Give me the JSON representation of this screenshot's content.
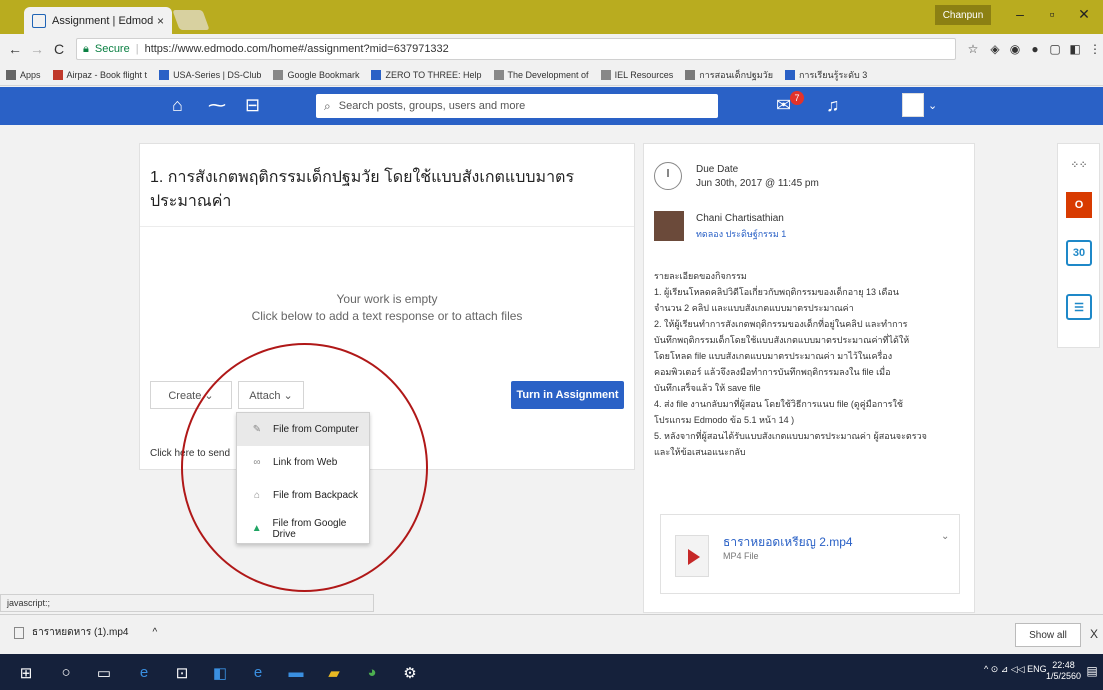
{
  "browser": {
    "tab_title": "Assignment | Edmodo",
    "tab_close": "×",
    "profile_name": "Chanpun",
    "url_secure": "Secure",
    "url": "https://www.edmodo.com/home#/assignment?mid=637971332"
  },
  "bookmarks": [
    {
      "label": "Apps",
      "color": "#666666"
    },
    {
      "label": "Airpaz - Book flight t",
      "color": "#c0392b"
    },
    {
      "label": "USA-Series | DS-Club",
      "color": "#2a61c6"
    },
    {
      "label": "Google Bookmark",
      "color": "#888888"
    },
    {
      "label": "ZERO TO THREE: Help",
      "color": "#2a61c6"
    },
    {
      "label": "The Development of",
      "color": "#888888"
    },
    {
      "label": "IEL Resources",
      "color": "#888888"
    },
    {
      "label": "การสอนเด็กปฐมวัย",
      "color": "#7a7a7a"
    },
    {
      "label": "การเรียนรู้ระดับ 3",
      "color": "#2a61c6"
    }
  ],
  "edmodo": {
    "search_placeholder": "Search posts, groups, users and more",
    "notification_count": "7"
  },
  "assignment": {
    "title": "1. การสังเกตพฤติกรรมเด็กปฐมวัย โดยใช้แบบสังเกตแบบมาตรประมาณค่า",
    "empty_line1": "Your work is empty",
    "empty_line2": "Click below to add a text response or to attach files",
    "create_label": "Create  ⌄",
    "attach_label": "Attach  ⌄",
    "turnin_label": "Turn in Assignment",
    "send_link": "Click here to send"
  },
  "attach_menu": [
    {
      "icon": "paperclip-icon",
      "glyph": "✎",
      "label": "File from Computer"
    },
    {
      "icon": "link-icon",
      "glyph": "∞",
      "label": "Link from Web"
    },
    {
      "icon": "backpack-icon",
      "glyph": "⌂",
      "label": "File from Backpack"
    },
    {
      "icon": "google-drive-icon",
      "glyph": "▲",
      "label": "File from Google Drive"
    }
  ],
  "side": {
    "due_label": "Due Date",
    "due_date": "Jun 30th, 2017 @ 11:45 pm",
    "teacher_name": "Chani Chartisathian",
    "teacher_group": "ทดลอง ประดิษฐ์กรรม 1",
    "desc_heading": "รายละเอียดของกิจกรรม",
    "desc_lines": [
      "1. ผู้เรียนโหลดคลิปวิดีโอเกี่ยวกับพฤติกรรมของเด็กอายุ 13 เดือน",
      "จำนวน 2 คลิป และแบบสังเกตแบบมาตรประมาณค่า",
      "2. ให้ผู้เรียนทำการสังเกตพฤติกรรมของเด็กที่อยู่ในคลิป และทำการ",
      "บันทึกพฤติกรรมเด็กโดยใช้แบบสังเกตแบบมาตรประมาณค่าที่ได้ให้",
      "โดยโหลด file แบบสังเกตแบบมาตรประมาณค่า มาไว้ในเครื่อง",
      "คอมพิวเตอร์ แล้วจึงลงมือทำการบันทึกพฤติกรรมลงใน file เมื่อ",
      "บันทึกเสร็จแล้ว ให้ save file",
      "4. ส่ง file งานกลับมาที่ผู้สอน โดยใช้วิธีการแนบ file (ดูคู่มือการใช้",
      "โปรแกรม Edmodo ข้อ 5.1 หน้า 14 )",
      "5. หลังจากที่ผู้สอนได้รับแบบสังเกตแบบมาตรประมาณค่า ผู้สอนจะตรวจ",
      "และให้ข้อเสนอแนะกลับ"
    ],
    "file_name": "ธาราหยอดเหรียญ 2.mp4",
    "file_type": "MP4 File"
  },
  "apps": [
    {
      "icon": "apps-grid-icon",
      "label": "⁘⁘",
      "color": "#777777"
    },
    {
      "icon": "office-icon",
      "label": "O",
      "color": "#d83b01"
    },
    {
      "icon": "calendar-icon",
      "label": "30",
      "color": "#1e88c8"
    },
    {
      "icon": "quiz-icon",
      "label": "☰",
      "color": "#1e88c8"
    }
  ],
  "status_url": "javascript:;",
  "download": {
    "file": "ธาราหยดหาร (1).mp4",
    "show_all": "Show all",
    "close": "X"
  },
  "taskbar": {
    "tray": "^  ⊙  ⊿  ◁◁  ENG",
    "time": "22:48",
    "date": "1/5/2560"
  }
}
